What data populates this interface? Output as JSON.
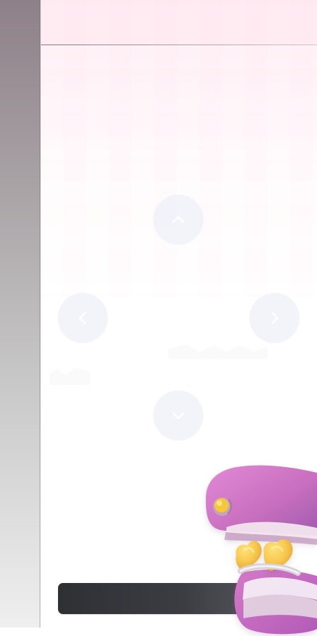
{
  "navigation": {
    "up_icon": "chevron-up-icon",
    "left_icon": "chevron-left-icon",
    "right_icon": "chevron-right-icon",
    "down_icon": "chevron-down-icon"
  },
  "bottom_bar": {
    "label": ""
  },
  "colors": {
    "background_tint": "#fff0f5",
    "rail_top": "#8e8088",
    "rail_bottom": "#efefef",
    "button_fill": "#eff1f9",
    "chevron": "#ffffff",
    "bottom_bar": "#35363b",
    "mascot_pink": "#cf72c8",
    "heart_yellow": "#f6c64f"
  }
}
